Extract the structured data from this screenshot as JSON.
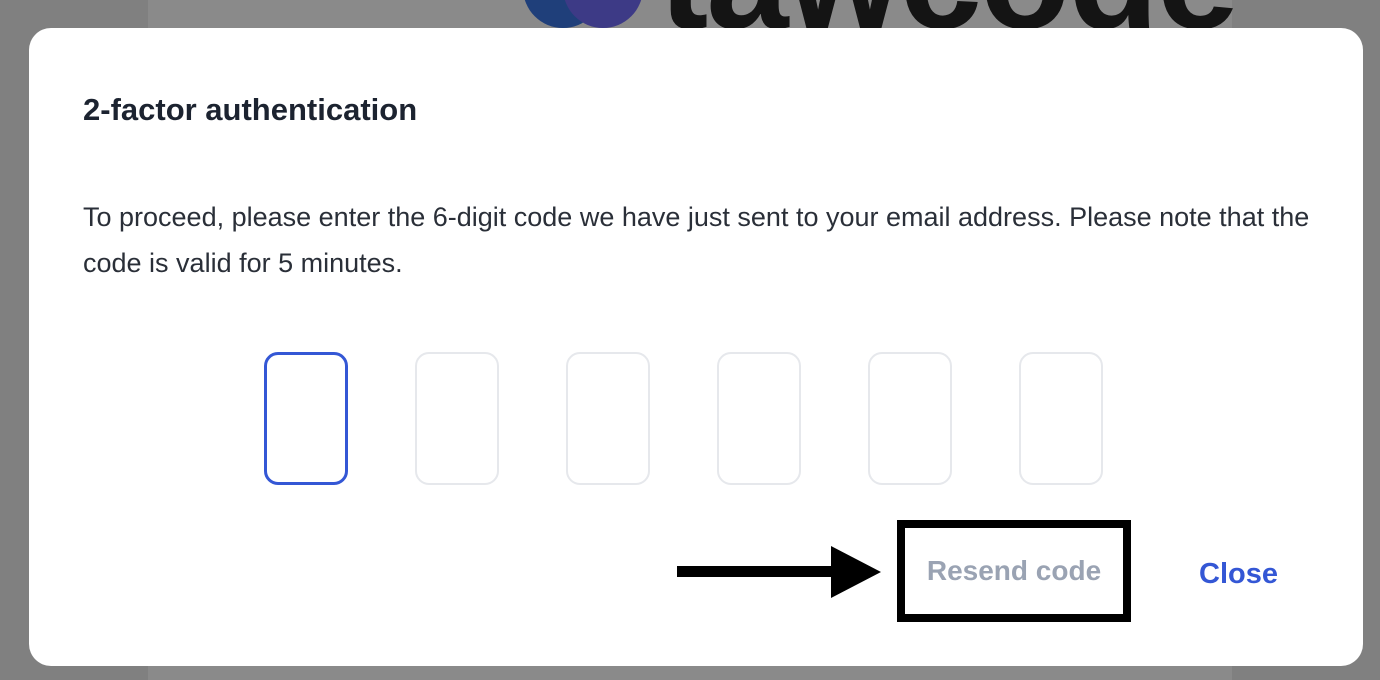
{
  "background": {
    "logo_text": "tawcode"
  },
  "modal": {
    "title": "2-factor authentication",
    "description": "To proceed, please enter the 6-digit code we have just sent to your email address. Please note that the code is valid for 5 minutes.",
    "code_digits": [
      "",
      "",
      "",
      "",
      "",
      ""
    ],
    "resend_label": "Resend code",
    "close_label": "Close"
  },
  "colors": {
    "accent": "#3457d5",
    "disabled_text": "#9aa3b3",
    "overlay": "#808080"
  },
  "icons": {
    "annotation_arrow": "right-arrow-icon"
  }
}
